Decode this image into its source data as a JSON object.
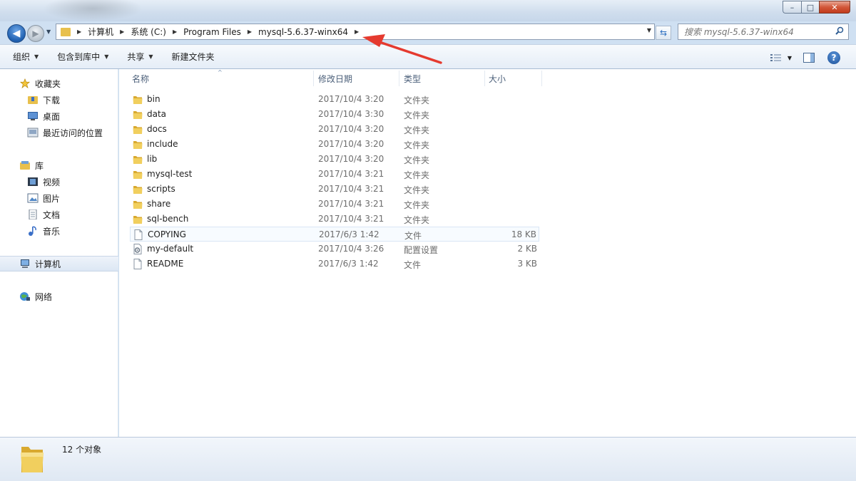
{
  "window": {
    "minimize_glyph": "–",
    "maximize_glyph": "□",
    "close_glyph": "✕"
  },
  "address": {
    "breadcrumbs": [
      "计算机",
      "系统 (C:)",
      "Program Files",
      "mysql-5.6.37-winx64"
    ],
    "search_placeholder": "搜索 mysql-5.6.37-winx64"
  },
  "toolbar": {
    "organize": "组织",
    "include_in_library": "包含到库中",
    "share": "共享",
    "new_folder": "新建文件夹"
  },
  "navpane": {
    "favorites": {
      "label": "收藏夹",
      "icon": "star-icon"
    },
    "downloads": {
      "label": "下载",
      "icon": "downloads-folder-icon"
    },
    "desktop": {
      "label": "桌面",
      "icon": "desktop-icon"
    },
    "recent": {
      "label": "最近访问的位置",
      "icon": "recent-places-icon"
    },
    "libraries": {
      "label": "库",
      "icon": "library-icon"
    },
    "videos": {
      "label": "视频",
      "icon": "video-icon"
    },
    "pictures": {
      "label": "图片",
      "icon": "pictures-icon"
    },
    "documents": {
      "label": "文档",
      "icon": "documents-icon"
    },
    "music": {
      "label": "音乐",
      "icon": "music-icon"
    },
    "computer": {
      "label": "计算机",
      "icon": "computer-icon"
    },
    "network": {
      "label": "网络",
      "icon": "network-icon"
    }
  },
  "columns": {
    "name": "名称",
    "date": "修改日期",
    "type": "类型",
    "size": "大小"
  },
  "files": [
    {
      "name": "bin",
      "date": "2017/10/4 3:20",
      "type": "文件夹",
      "size": "",
      "kind": "folder"
    },
    {
      "name": "data",
      "date": "2017/10/4 3:30",
      "type": "文件夹",
      "size": "",
      "kind": "folder"
    },
    {
      "name": "docs",
      "date": "2017/10/4 3:20",
      "type": "文件夹",
      "size": "",
      "kind": "folder"
    },
    {
      "name": "include",
      "date": "2017/10/4 3:20",
      "type": "文件夹",
      "size": "",
      "kind": "folder"
    },
    {
      "name": "lib",
      "date": "2017/10/4 3:20",
      "type": "文件夹",
      "size": "",
      "kind": "folder"
    },
    {
      "name": "mysql-test",
      "date": "2017/10/4 3:21",
      "type": "文件夹",
      "size": "",
      "kind": "folder"
    },
    {
      "name": "scripts",
      "date": "2017/10/4 3:21",
      "type": "文件夹",
      "size": "",
      "kind": "folder"
    },
    {
      "name": "share",
      "date": "2017/10/4 3:21",
      "type": "文件夹",
      "size": "",
      "kind": "folder"
    },
    {
      "name": "sql-bench",
      "date": "2017/10/4 3:21",
      "type": "文件夹",
      "size": "",
      "kind": "folder"
    },
    {
      "name": "COPYING",
      "date": "2017/6/3 1:42",
      "type": "文件",
      "size": "18 KB",
      "kind": "file"
    },
    {
      "name": "my-default",
      "date": "2017/10/4 3:26",
      "type": "配置设置",
      "size": "2 KB",
      "kind": "config"
    },
    {
      "name": "README",
      "date": "2017/6/3 1:42",
      "type": "文件",
      "size": "3 KB",
      "kind": "file"
    }
  ],
  "details": {
    "count": "12 个对象"
  },
  "colors": {
    "folder": "#e8c04d",
    "annotation_arrow": "#e53a2f",
    "selection": "#dce7f4"
  }
}
